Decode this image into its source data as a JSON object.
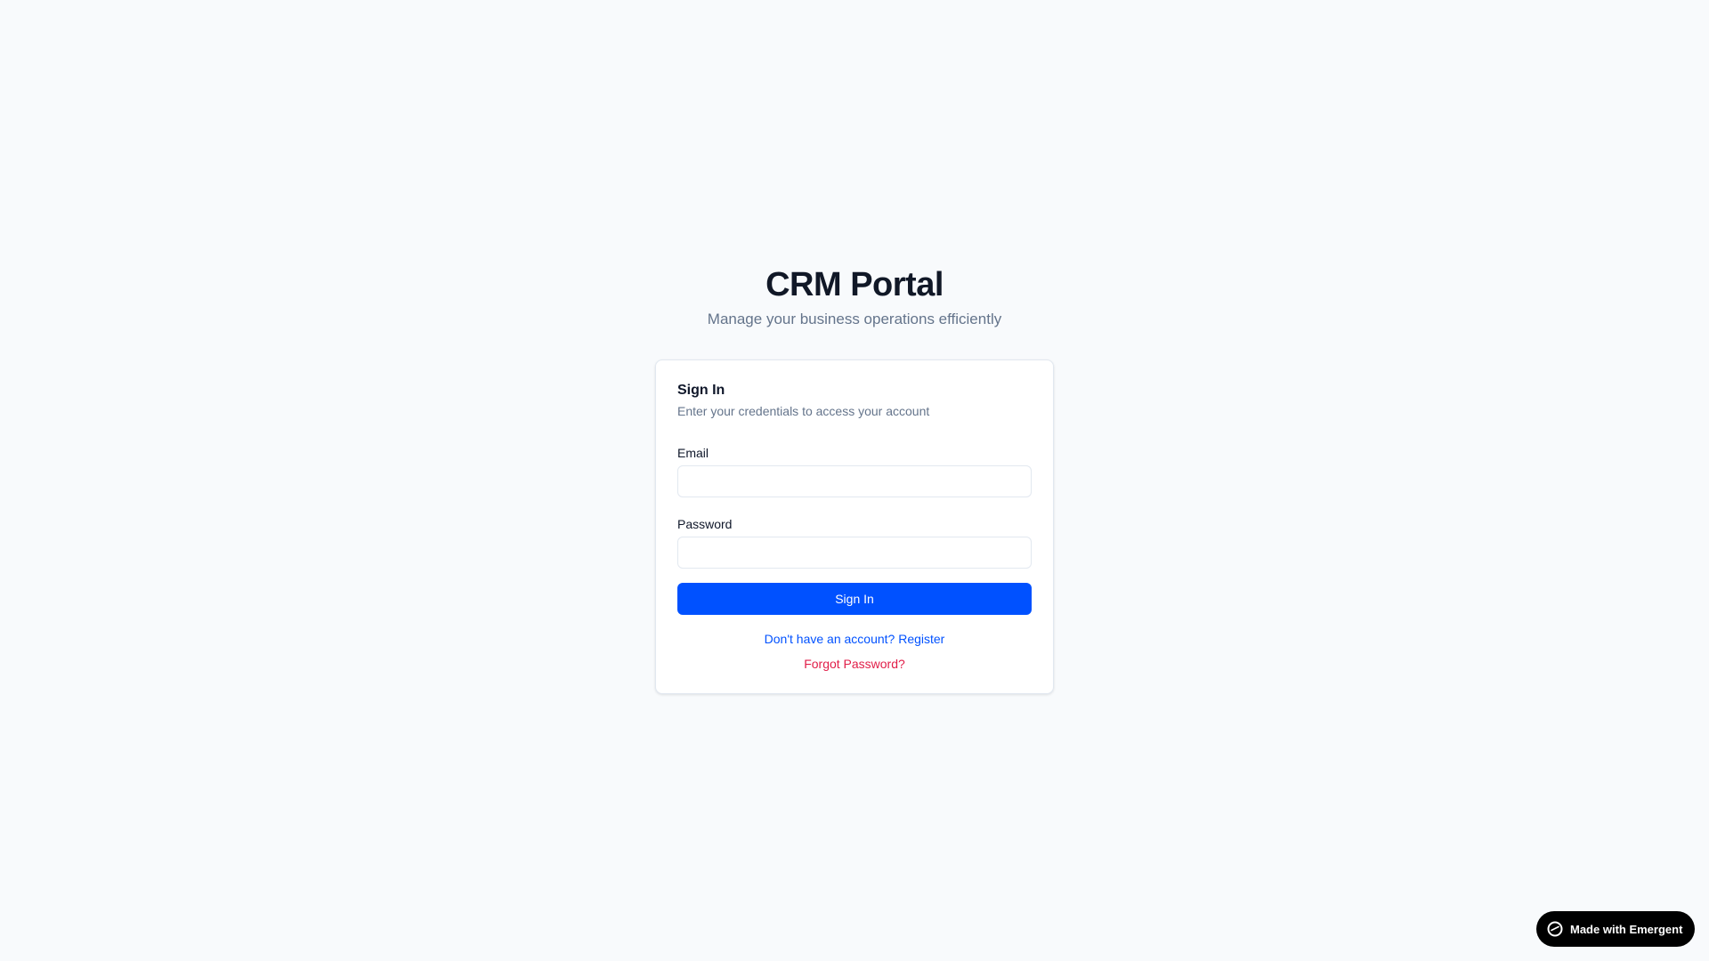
{
  "header": {
    "title": "CRM Portal",
    "subtitle": "Manage your business operations efficiently"
  },
  "login_card": {
    "title": "Sign In",
    "description": "Enter your credentials to access your account",
    "email_label": "Email",
    "email_value": "",
    "password_label": "Password",
    "password_value": "",
    "submit_label": "Sign In",
    "register_link": "Don't have an account? Register",
    "forgot_link": "Forgot Password?"
  },
  "badge": {
    "label": "Made with Emergent",
    "icon": "emergent-logo-icon"
  },
  "colors": {
    "background": "#f8fafc",
    "primary": "#0051ff",
    "danger_link": "#e11d48",
    "muted_text": "#64748b",
    "badge_bg": "#000000"
  }
}
